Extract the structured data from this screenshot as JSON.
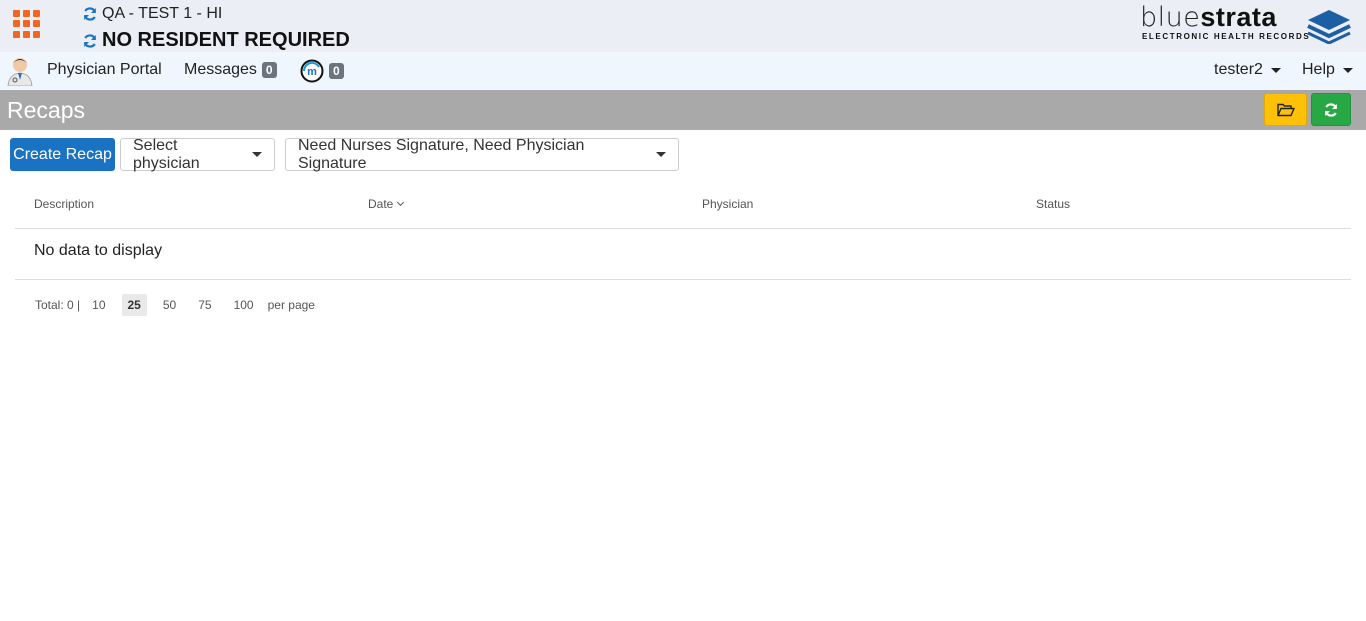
{
  "header": {
    "facility": "QA - TEST 1 - HI",
    "resident": "NO RESIDENT REQUIRED",
    "logo": {
      "blue": "blue",
      "strata": "strata",
      "sub": "ELECTRONIC HEALTH RECORDS"
    },
    "colors": {
      "apps": "#f26522",
      "sync": "#1a73c2"
    }
  },
  "nav": {
    "portal": "Physician Portal",
    "messages": "Messages",
    "messages_count": "0",
    "m_count": "0",
    "user": "tester2",
    "help": "Help"
  },
  "page": {
    "title": "Recaps",
    "create_label": "Create Recap",
    "physician_select": "Select physician",
    "status_filter": "Need Nurses Signature, Need Physician Signature"
  },
  "table": {
    "columns": [
      "Description",
      "Date",
      "Physician",
      "Status"
    ],
    "empty_text": "No data to display"
  },
  "pager": {
    "total": "Total: 0 |",
    "sizes": [
      "10",
      "25",
      "50",
      "75",
      "100"
    ],
    "active": "25",
    "per_page": "per page"
  }
}
